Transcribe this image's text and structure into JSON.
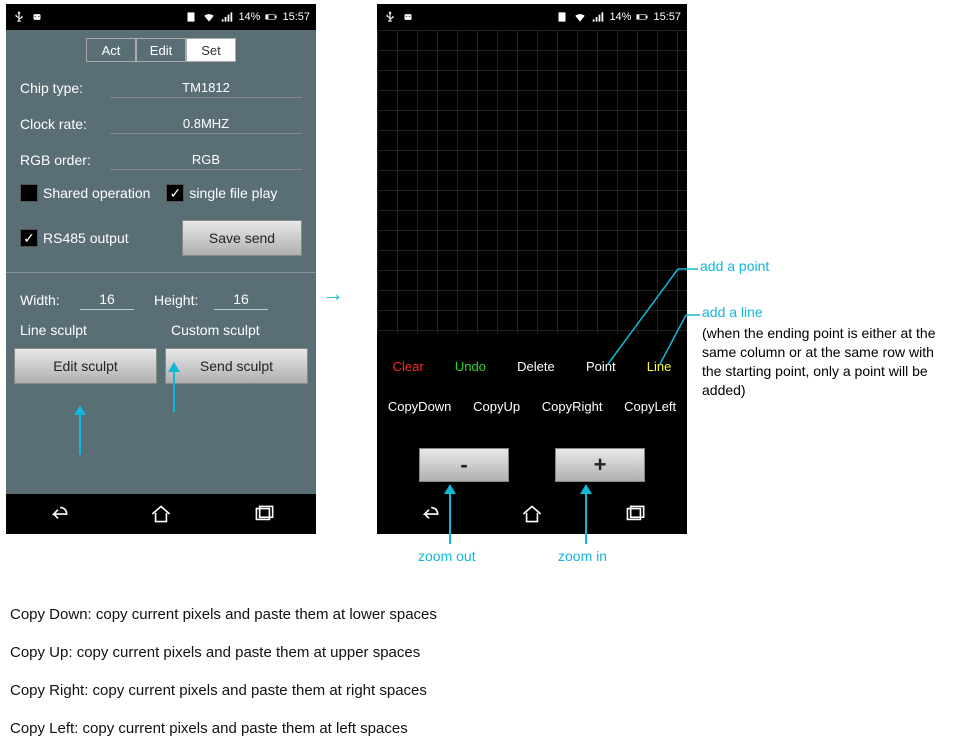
{
  "statusbar": {
    "battery": "14%",
    "time": "15:57"
  },
  "left": {
    "tabs": {
      "act": "Act",
      "edit": "Edit",
      "set": "Set"
    },
    "chip_type_label": "Chip type:",
    "chip_type_value": "TM1812",
    "clock_rate_label": "Clock rate:",
    "clock_rate_value": "0.8MHZ",
    "rgb_order_label": "RGB order:",
    "rgb_order_value": "RGB",
    "shared_op": "Shared operation",
    "single_file": "single file play",
    "rs485": "RS485 output",
    "save_send": "Save send",
    "width_label": "Width:",
    "width_value": "16",
    "height_label": "Height:",
    "height_value": "16",
    "line_sculpt": "Line sculpt",
    "custom_sculpt": "Custom sculpt",
    "edit_sculpt": "Edit sculpt",
    "send_sculpt": "Send sculpt"
  },
  "right": {
    "clear": "Clear",
    "undo": "Undo",
    "delete": "Delete",
    "point": "Point",
    "line": "Line",
    "copy_down": "CopyDown",
    "copy_up": "CopyUp",
    "copy_right": "CopyRight",
    "copy_left": "CopyLeft",
    "minus": "-",
    "plus": "+"
  },
  "annot": {
    "add_point": "add a point",
    "add_line": "add a line",
    "add_line_note": "(when the ending point is either at the same column or at the same row with the starting point, only a point will be added)",
    "zoom_out": "zoom out",
    "zoom_in": "zoom in"
  },
  "doc": {
    "l1": "Copy Down: copy current pixels and paste them at lower spaces",
    "l2": "Copy Up: copy current pixels and paste them at upper spaces",
    "l3": "Copy Right: copy current pixels and paste them at right spaces",
    "l4": "Copy Left: copy current pixels and paste them at left spaces"
  },
  "colors": {
    "clear": "#ff2a2a",
    "undo": "#2dd82d",
    "delete": "#ffffff",
    "point": "#ffffff",
    "line": "#ffff33",
    "cyan": "#12b8d8"
  }
}
